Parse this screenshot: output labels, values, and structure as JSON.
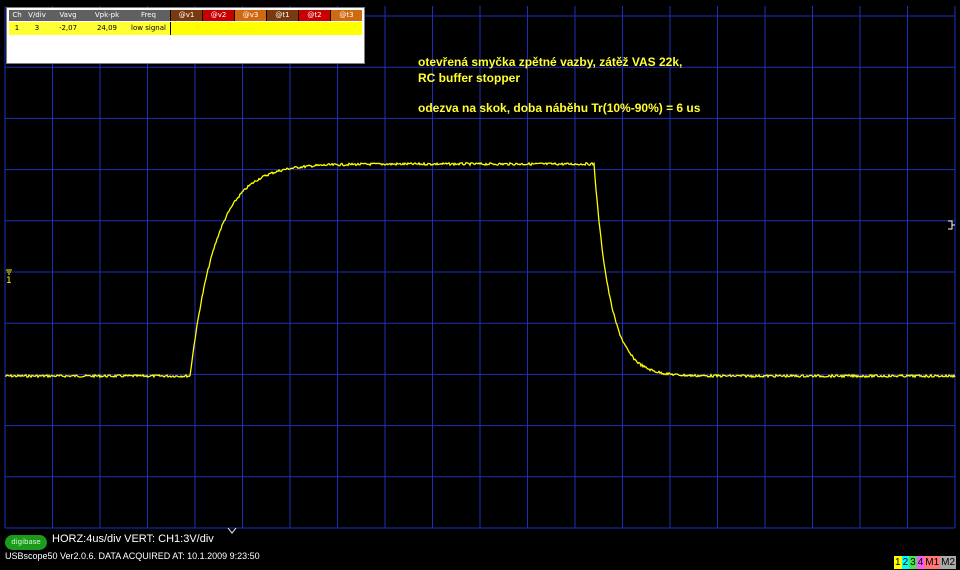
{
  "measurements": {
    "headers": [
      "Ch",
      "V/div",
      "Vavg",
      "Vpk-pk",
      "Freq"
    ],
    "row": [
      "1",
      "3",
      "-2,07",
      "24,09",
      "low signal"
    ],
    "cursor_headers": [
      "@v1",
      "@v2",
      "@v3",
      "@t1",
      "@t2",
      "@t3"
    ],
    "cursor_colors": [
      "#7a3a10",
      "#c80000",
      "#d06a10",
      "#7a3a10",
      "#c80000",
      "#d06a10"
    ]
  },
  "annotations": {
    "line1": "otevřená smyčka zpětné vazby, zátěž VAS 22k,",
    "line2": "RC buffer stopper",
    "line3": "odezva na skok, doba náběhu Tr(10%-90%) = 6 us"
  },
  "scope": {
    "trace_color": "#ffff00",
    "grid_color": "#1d2fb8",
    "horz_scale": "4us/div",
    "vert_scale": "3V/div",
    "scale_readout": "HORZ:4us/div VERT: CH1:3V/div",
    "logo_text": "digibase",
    "status": "USBscope50 Ver2.0.6.   DATA ACQUIRED AT: 10.1.2009 9:23:50",
    "channel_buttons": [
      {
        "label": "1",
        "color": "#ffff00"
      },
      {
        "label": "2",
        "color": "#00ffff"
      },
      {
        "label": "3",
        "color": "#4de14d"
      },
      {
        "label": "4",
        "color": "#ff55ff"
      },
      {
        "label": "M1",
        "color": "#ff7777"
      },
      {
        "label": "M2",
        "color": "#aaaaaa"
      }
    ]
  }
}
